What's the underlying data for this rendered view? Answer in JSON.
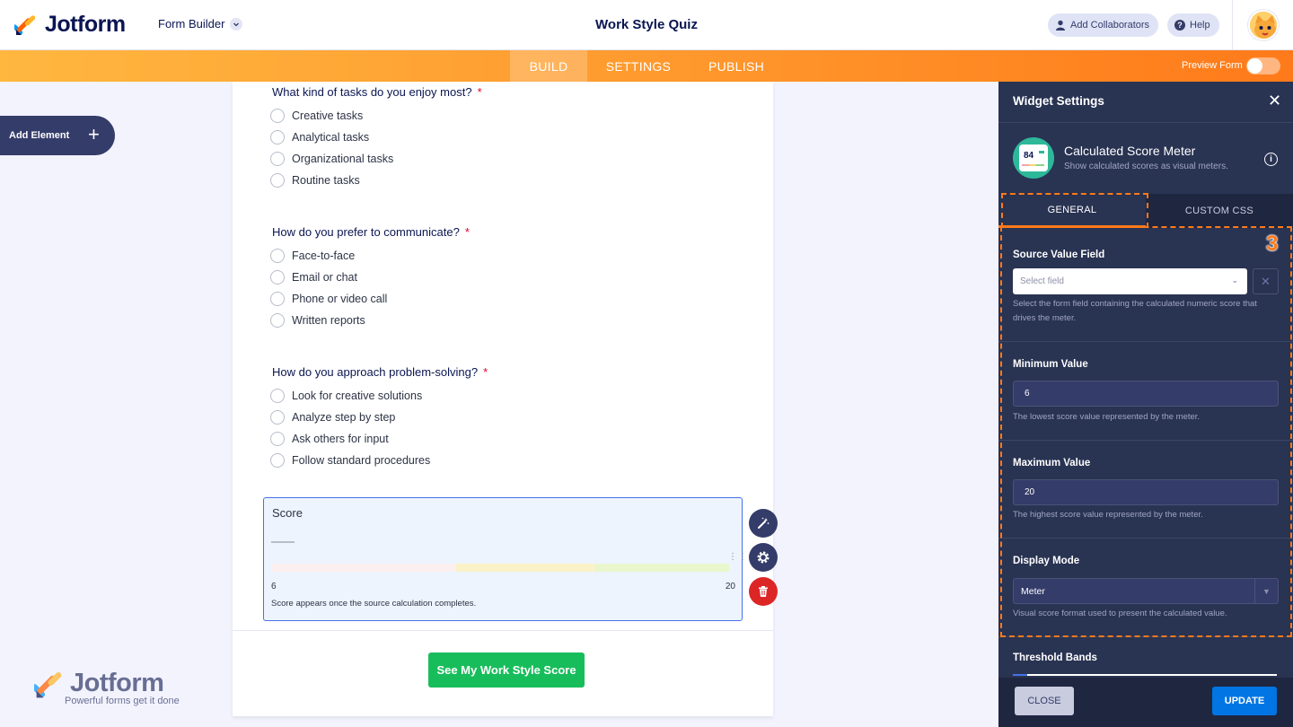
{
  "header": {
    "brand": "Jotform",
    "builder_menu": "Form Builder",
    "form_title": "Work Style Quiz",
    "add_collaborators": "Add Collaborators",
    "help": "Help"
  },
  "nav": {
    "tabs": [
      {
        "label": "BUILD",
        "active": true
      },
      {
        "label": "SETTINGS",
        "active": false
      },
      {
        "label": "PUBLISH",
        "active": false
      }
    ],
    "preview_label": "Preview Form",
    "preview_enabled": false
  },
  "sidebar": {
    "add_element": "Add Element"
  },
  "form": {
    "questions": [
      {
        "label": "What kind of tasks do you enjoy most?",
        "required_mark": "*",
        "options": [
          "Creative tasks",
          "Analytical tasks",
          "Organizational tasks",
          "Routine tasks"
        ]
      },
      {
        "label": "How do you prefer to communicate?",
        "required_mark": "*",
        "options": [
          "Face-to-face",
          "Email or chat",
          "Phone or video call",
          "Written reports"
        ]
      },
      {
        "label": "How do you approach problem-solving?",
        "required_mark": "*",
        "options": [
          "Look for creative solutions",
          "Analyze step by step",
          "Ask others for input",
          "Follow standard procedures"
        ]
      }
    ],
    "score_widget": {
      "title": "Score",
      "min": "6",
      "max": "20",
      "note": "Score appears once the source calculation completes.",
      "band_colors": [
        "#fbeff0",
        "#fbf2c7",
        "#eaf6cc"
      ]
    },
    "submit_label": "See My Work Style Score"
  },
  "watermark": {
    "brand": "Jotform",
    "tagline": "Powerful forms get it done"
  },
  "panel": {
    "title": "Widget Settings",
    "widget": {
      "name": "Calculated Score Meter",
      "description": "Show calculated scores as visual meters.",
      "icon_value": "84"
    },
    "tabs": [
      {
        "label": "GENERAL",
        "active": true
      },
      {
        "label": "CUSTOM CSS",
        "active": false
      }
    ],
    "step_number": "3",
    "fields": {
      "source": {
        "label": "Source Value Field",
        "placeholder": "Select field",
        "help": "Select the form field containing the calculated numeric score that drives the meter."
      },
      "minimum": {
        "label": "Minimum Value",
        "value": "6",
        "help": "The lowest score value represented by the meter."
      },
      "maximum": {
        "label": "Maximum Value",
        "value": "20",
        "help": "The highest score value represented by the meter."
      },
      "display_mode": {
        "label": "Display Mode",
        "value": "Meter",
        "help": "Visual score format used to present the calculated value."
      },
      "threshold_bands": {
        "label": "Threshold Bands"
      }
    },
    "buttons": {
      "close": "CLOSE",
      "update": "UPDATE"
    }
  },
  "colors": {
    "brand_orange": "#ff7a1a",
    "panel_bg": "#293352",
    "submit_green": "#18bd5b",
    "update_blue": "#0075e3",
    "required_red": "#e3002b"
  }
}
